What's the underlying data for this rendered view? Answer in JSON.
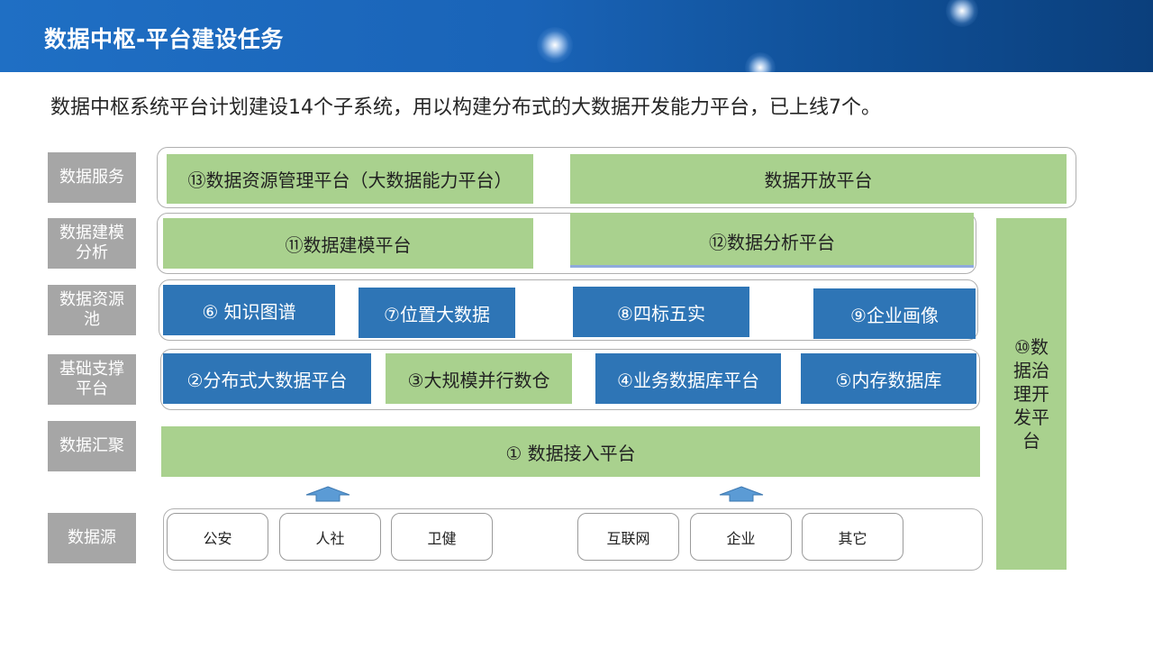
{
  "header": {
    "title": "数据中枢-平台建设任务"
  },
  "intro": "数据中枢系统平台计划建设14个子系统，用以构建分布式的大数据开发能力平台，已上线7个。",
  "colors": {
    "header_blue": "#1a64b8",
    "green": "#a9d18e",
    "blue": "#2e75b6",
    "label_gray": "#a6a6a6"
  },
  "layers": {
    "service": {
      "label": "数据服务",
      "items": [
        "⑬数据资源管理平台（大数据能力平台）",
        "数据开放平台"
      ]
    },
    "modeling": {
      "label": "数据建模分析",
      "items": [
        "⑪数据建模平台",
        "⑫数据分析平台"
      ]
    },
    "resource_pool": {
      "label": "数据资源池",
      "items": [
        "⑥ 知识图谱",
        "⑦位置大数据",
        "⑧四标五实",
        "⑨企业画像"
      ]
    },
    "foundation": {
      "label": "基础支撑平台",
      "items": [
        "②分布式大数据平台",
        "③大规模并行数仓",
        "④业务数据库平台",
        "⑤内存数据库"
      ]
    },
    "aggregation": {
      "label": "数据汇聚",
      "items": [
        "① 数据接入平台"
      ]
    },
    "sources": {
      "label": "数据源",
      "items": [
        "公安",
        "人社",
        "卫健",
        "互联网",
        "企业",
        "其它"
      ]
    }
  },
  "governance": "⑩数据治理开发平台",
  "icons": {
    "upload_arrow": "up-arrow-icon"
  }
}
